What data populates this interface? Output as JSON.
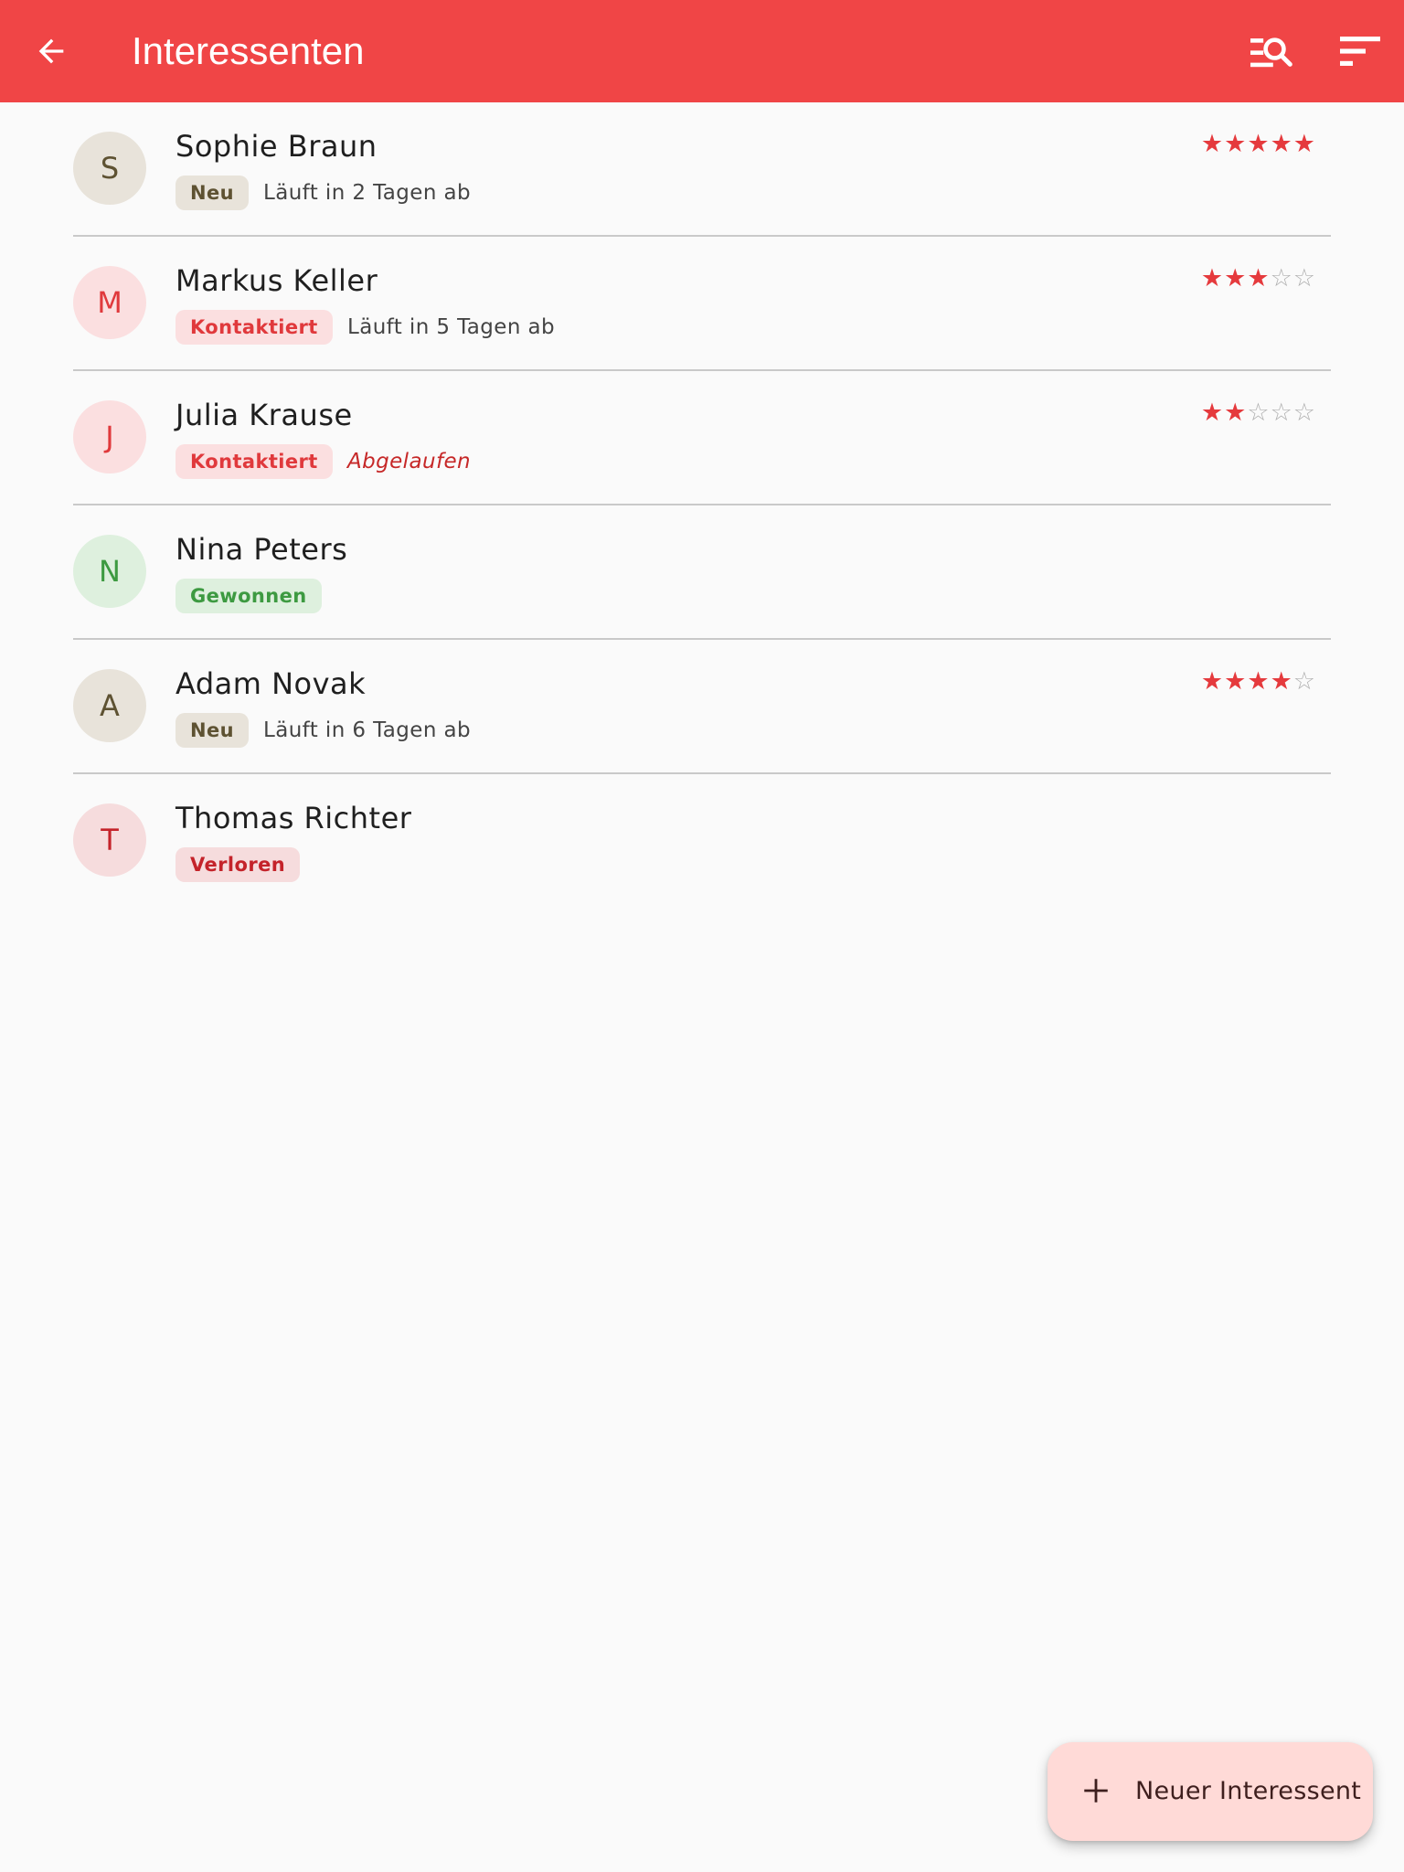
{
  "header": {
    "title": "Interessenten",
    "back_icon": "arrow-back-icon",
    "search_icon": "manage-search-icon",
    "sort_icon": "sort-icon",
    "color": "#f04546"
  },
  "leads": [
    {
      "initial": "S",
      "name": "Sophie Braun",
      "status": "Neu",
      "status_kind": "neu",
      "expiry": "Läuft in 2 Tagen ab",
      "expired": false,
      "rating": 5
    },
    {
      "initial": "M",
      "name": "Markus Keller",
      "status": "Kontaktiert",
      "status_kind": "kontaktiert",
      "expiry": "Läuft in 5 Tagen ab",
      "expired": false,
      "rating": 3
    },
    {
      "initial": "J",
      "name": "Julia Krause",
      "status": "Kontaktiert",
      "status_kind": "kontaktiert",
      "expiry": "Abgelaufen",
      "expired": true,
      "rating": 2
    },
    {
      "initial": "N",
      "name": "Nina Peters",
      "status": "Gewonnen",
      "status_kind": "gewonnen",
      "expiry": "",
      "expired": false,
      "rating": 0
    },
    {
      "initial": "A",
      "name": "Adam Novak",
      "status": "Neu",
      "status_kind": "neu",
      "expiry": "Läuft in 6 Tagen ab",
      "expired": false,
      "rating": 4
    },
    {
      "initial": "T",
      "name": "Thomas Richter",
      "status": "Verloren",
      "status_kind": "verloren",
      "expiry": "",
      "expired": false,
      "rating": 0
    }
  ],
  "status_colors": {
    "neu": {
      "bg": "#e8e3da",
      "fg": "#5e5232"
    },
    "kontaktiert": {
      "bg": "#fbdfe0",
      "fg": "#e0393c"
    },
    "gewonnen": {
      "bg": "#def0de",
      "fg": "#3d9a41"
    },
    "verloren": {
      "bg": "#f6dcdd",
      "fg": "#c4232a"
    }
  },
  "fab": {
    "label": "Neuer Interessent",
    "icon": "plus-icon"
  }
}
